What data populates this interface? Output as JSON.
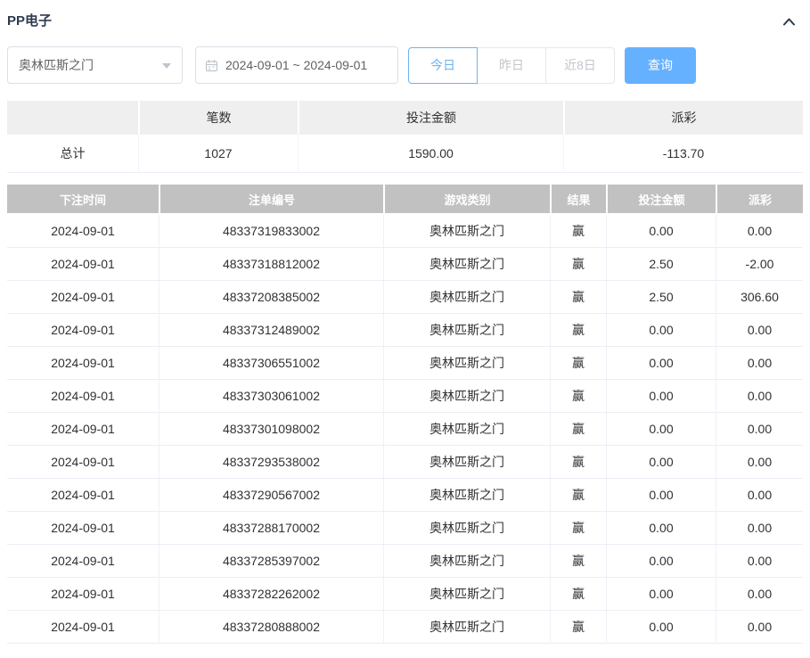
{
  "colors": {
    "accent_blue": "#66b1ff",
    "active_blue": "#6db3f3",
    "negative_red": "#f56c6c",
    "table_header_bg": "#c1c1c1",
    "summary_header_bg": "#efefef",
    "title_color": "#2e3a4e",
    "border_light": "#ebeef5"
  },
  "panel": {
    "title": "PP电子"
  },
  "filters": {
    "game_select": {
      "value": "奥林匹斯之门"
    },
    "date_range": {
      "value": "2024-09-01 ~ 2024-09-01"
    },
    "quick_buttons": [
      {
        "label": "今日",
        "active": true
      },
      {
        "label": "昨日",
        "active": false
      },
      {
        "label": "近8日",
        "active": false
      }
    ],
    "search_button": "查询"
  },
  "summary": {
    "columns": [
      "",
      "笔数",
      "投注金额",
      "派彩"
    ],
    "total": {
      "label": "总计",
      "count": "1027",
      "bet_amount": "1590.00",
      "payout": "-113.70"
    }
  },
  "table": {
    "columns": [
      "下注时间",
      "注单编号",
      "游戏类别",
      "结果",
      "投注金额",
      "派彩"
    ],
    "rows": [
      {
        "date": "2024-09-01",
        "order_no": "48337319833002",
        "game": "奥林匹斯之门",
        "result": "赢",
        "bet": "0.00",
        "payout": "0.00"
      },
      {
        "date": "2024-09-01",
        "order_no": "48337318812002",
        "game": "奥林匹斯之门",
        "result": "赢",
        "bet": "2.50",
        "payout": "-2.00"
      },
      {
        "date": "2024-09-01",
        "order_no": "48337208385002",
        "game": "奥林匹斯之门",
        "result": "赢",
        "bet": "2.50",
        "payout": "306.60"
      },
      {
        "date": "2024-09-01",
        "order_no": "48337312489002",
        "game": "奥林匹斯之门",
        "result": "赢",
        "bet": "0.00",
        "payout": "0.00"
      },
      {
        "date": "2024-09-01",
        "order_no": "48337306551002",
        "game": "奥林匹斯之门",
        "result": "赢",
        "bet": "0.00",
        "payout": "0.00"
      },
      {
        "date": "2024-09-01",
        "order_no": "48337303061002",
        "game": "奥林匹斯之门",
        "result": "赢",
        "bet": "0.00",
        "payout": "0.00"
      },
      {
        "date": "2024-09-01",
        "order_no": "48337301098002",
        "game": "奥林匹斯之门",
        "result": "赢",
        "bet": "0.00",
        "payout": "0.00"
      },
      {
        "date": "2024-09-01",
        "order_no": "48337293538002",
        "game": "奥林匹斯之门",
        "result": "赢",
        "bet": "0.00",
        "payout": "0.00"
      },
      {
        "date": "2024-09-01",
        "order_no": "48337290567002",
        "game": "奥林匹斯之门",
        "result": "赢",
        "bet": "0.00",
        "payout": "0.00"
      },
      {
        "date": "2024-09-01",
        "order_no": "48337288170002",
        "game": "奥林匹斯之门",
        "result": "赢",
        "bet": "0.00",
        "payout": "0.00"
      },
      {
        "date": "2024-09-01",
        "order_no": "48337285397002",
        "game": "奥林匹斯之门",
        "result": "赢",
        "bet": "0.00",
        "payout": "0.00"
      },
      {
        "date": "2024-09-01",
        "order_no": "48337282262002",
        "game": "奥林匹斯之门",
        "result": "赢",
        "bet": "0.00",
        "payout": "0.00"
      },
      {
        "date": "2024-09-01",
        "order_no": "48337280888002",
        "game": "奥林匹斯之门",
        "result": "赢",
        "bet": "0.00",
        "payout": "0.00"
      }
    ]
  }
}
